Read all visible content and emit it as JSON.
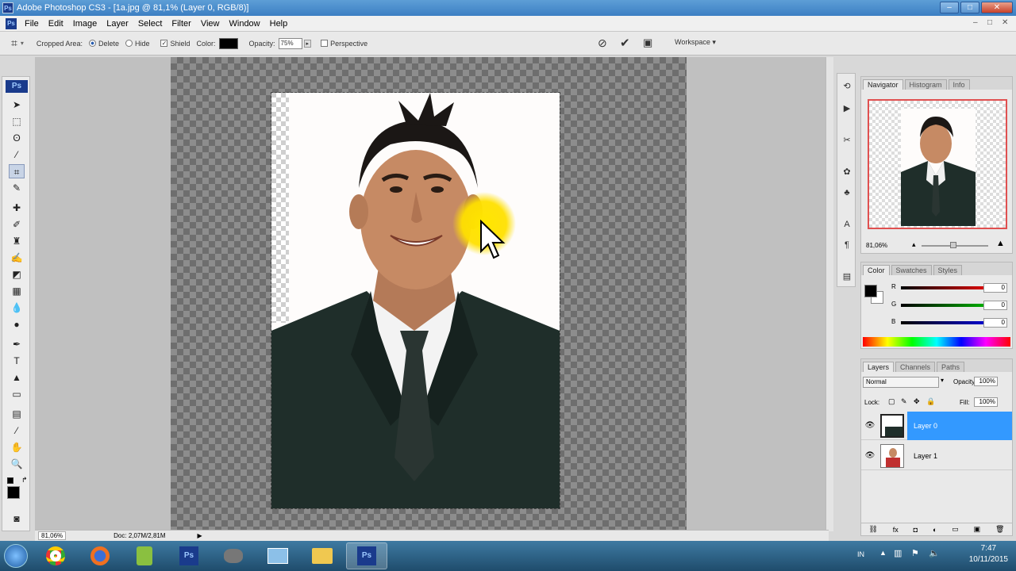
{
  "window": {
    "title": "Adobe Photoshop CS3 - [1a.jpg @ 81,1% (Layer 0, RGB/8)]",
    "ps_badge": "Ps",
    "minimize": "–",
    "maximize": "□",
    "close": "✕"
  },
  "menu": [
    "File",
    "Edit",
    "Image",
    "Layer",
    "Select",
    "Filter",
    "View",
    "Window",
    "Help"
  ],
  "options": {
    "cropped_area_label": "Cropped Area:",
    "delete_label": "Delete",
    "hide_label": "Hide",
    "shield_label": "Shield",
    "color_label": "Color:",
    "opacity_label": "Opacity:",
    "opacity_value": "75%",
    "perspective_label": "Perspective",
    "workspace_label": "Workspace ▾"
  },
  "status": {
    "zoom": "81,06%",
    "doc": "Doc: 2,07M/2,81M"
  },
  "navigator": {
    "tabs": [
      "Navigator",
      "Histogram",
      "Info"
    ],
    "zoom": "81,06%"
  },
  "color_panel": {
    "tabs": [
      "Color",
      "Swatches",
      "Styles"
    ],
    "channels": [
      {
        "label": "R",
        "value": "0",
        "color": "#e00000"
      },
      {
        "label": "G",
        "value": "0",
        "color": "#00b000"
      },
      {
        "label": "B",
        "value": "0",
        "color": "#0000d0"
      }
    ]
  },
  "layers_panel": {
    "tabs": [
      "Layers",
      "Channels",
      "Paths"
    ],
    "blend_mode": "Normal",
    "opacity_label": "Opacity:",
    "opacity_value": "100%",
    "lock_label": "Lock:",
    "fill_label": "Fill:",
    "fill_value": "100%",
    "layers": [
      {
        "name": "Layer 0",
        "selected": true
      },
      {
        "name": "Layer 1",
        "selected": false
      }
    ]
  },
  "taskbar": {
    "language": "IN",
    "time": "7:47",
    "date": "10/11/2015"
  },
  "colors": {
    "accent": "#3399ff",
    "selected_layer": "#3399ff"
  }
}
